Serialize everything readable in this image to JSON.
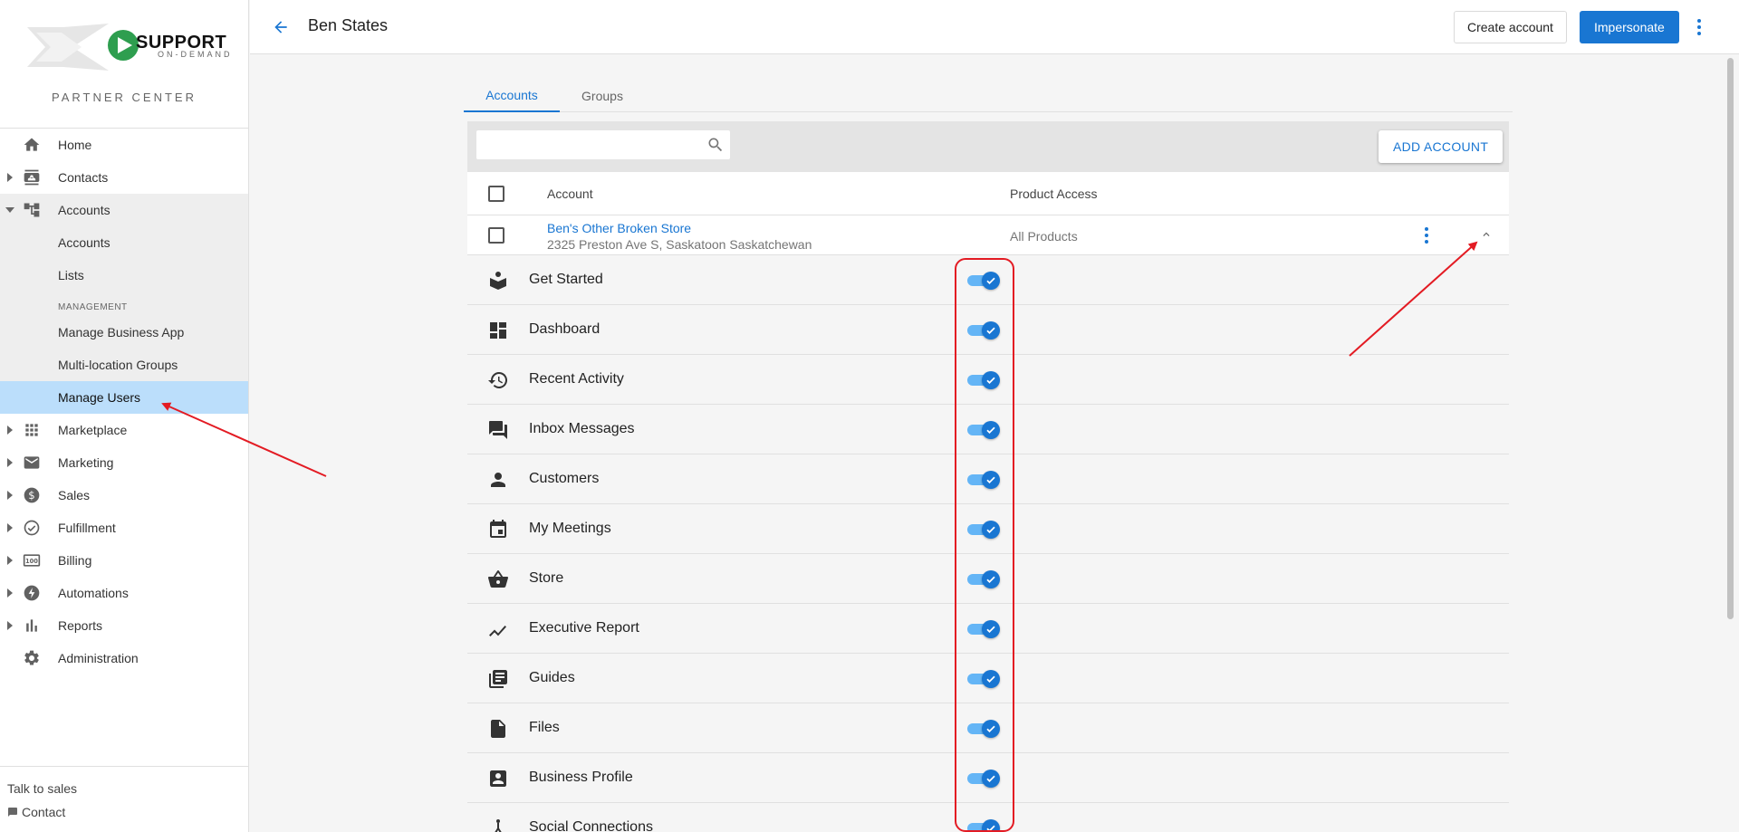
{
  "brand": {
    "name": "SUPPORT",
    "tagline": "ON-DEMAND",
    "section": "PARTNER CENTER"
  },
  "nav": {
    "home": "Home",
    "contacts": "Contacts",
    "accounts": "Accounts",
    "accounts_sub": "Accounts",
    "lists": "Lists",
    "management_label": "MANAGEMENT",
    "manage_business_app": "Manage Business App",
    "multi_location_groups": "Multi-location Groups",
    "manage_users": "Manage Users",
    "marketplace": "Marketplace",
    "marketing": "Marketing",
    "sales": "Sales",
    "fulfillment": "Fulfillment",
    "billing": "Billing",
    "automations": "Automations",
    "reports": "Reports",
    "administration": "Administration"
  },
  "footer": {
    "talk_to_sales": "Talk to sales",
    "contact": "Contact"
  },
  "header": {
    "title": "Ben States",
    "create_account": "Create account",
    "impersonate": "Impersonate"
  },
  "tabs": {
    "accounts": "Accounts",
    "groups": "Groups"
  },
  "toolbar": {
    "search_placeholder": "",
    "add_account": "ADD ACCOUNT"
  },
  "table": {
    "col_account": "Account",
    "col_product_access": "Product Access",
    "row": {
      "name": "Ben's Other Broken Store",
      "address": "2325 Preston Ave S, Saskatoon Saskatchewan",
      "access": "All Products"
    }
  },
  "features": [
    {
      "label": "Get Started",
      "icon": "get-started-icon",
      "enabled": true
    },
    {
      "label": "Dashboard",
      "icon": "dashboard-icon",
      "enabled": true
    },
    {
      "label": "Recent Activity",
      "icon": "history-icon",
      "enabled": true
    },
    {
      "label": "Inbox Messages",
      "icon": "chat-icon",
      "enabled": true
    },
    {
      "label": "Customers",
      "icon": "person-icon",
      "enabled": true
    },
    {
      "label": "My Meetings",
      "icon": "calendar-icon",
      "enabled": true
    },
    {
      "label": "Store",
      "icon": "basket-icon",
      "enabled": true
    },
    {
      "label": "Executive Report",
      "icon": "trend-icon",
      "enabled": true
    },
    {
      "label": "Guides",
      "icon": "library-icon",
      "enabled": true
    },
    {
      "label": "Files",
      "icon": "file-icon",
      "enabled": true
    },
    {
      "label": "Business Profile",
      "icon": "profile-icon",
      "enabled": true
    },
    {
      "label": "Social Connections",
      "icon": "social-icon",
      "enabled": true
    }
  ],
  "colors": {
    "primary": "#1976d2",
    "active_nav": "#bbdefb",
    "annotation": "#e31b23"
  }
}
